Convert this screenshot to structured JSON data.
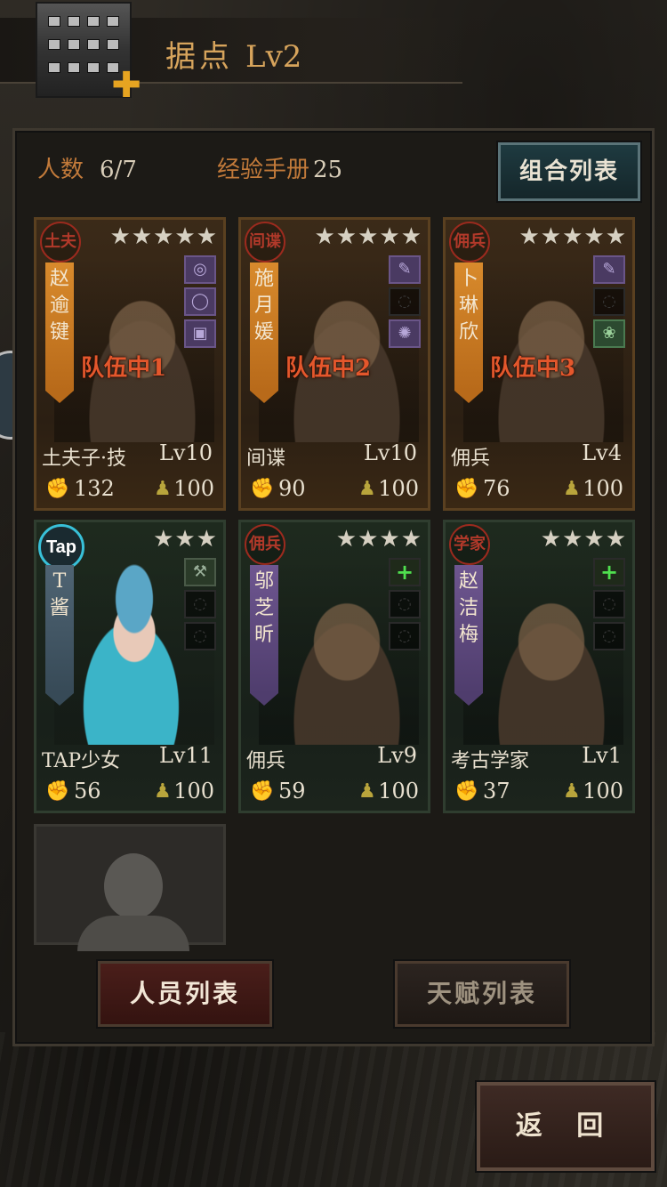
{
  "header": {
    "title": "据点",
    "level": "Lv2"
  },
  "stats": {
    "people_label": "人数",
    "people_value": "6/7",
    "exp_label": "经验手册",
    "exp_value": "25"
  },
  "combo_button": "组合列表",
  "cards": [
    {
      "stars": "★★★★★",
      "seal": "土夫",
      "name_vertical": "赵\n逾\n键",
      "team": "队伍中1",
      "class": "土夫子·技",
      "level": "Lv10",
      "power": "132",
      "stamina": "100"
    },
    {
      "stars": "★★★★★",
      "seal": "间谍",
      "name_vertical": "施\n月\n媛",
      "team": "队伍中2",
      "class": "间谍",
      "level": "Lv10",
      "power": "90",
      "stamina": "100"
    },
    {
      "stars": "★★★★★",
      "seal": "佣兵",
      "name_vertical": "卜\n琳\n欣",
      "team": "队伍中3",
      "class": "佣兵",
      "level": "Lv4",
      "power": "76",
      "stamina": "100"
    },
    {
      "stars": "★★★",
      "seal": "Tap",
      "name_vertical": "T\n酱",
      "team": "",
      "class": "TAP少女",
      "level": "Lv11",
      "power": "56",
      "stamina": "100"
    },
    {
      "stars": "★★★★",
      "seal": "佣兵",
      "name_vertical": "邬\n芝\n昕",
      "team": "",
      "class": "佣兵",
      "level": "Lv9",
      "power": "59",
      "stamina": "100"
    },
    {
      "stars": "★★★★",
      "seal": "学家",
      "name_vertical": "赵\n洁\n梅",
      "team": "",
      "class": "考古学家",
      "level": "Lv1",
      "power": "37",
      "stamina": "100"
    }
  ],
  "tabs": {
    "active": "人员列表",
    "inactive": "天赋列表"
  },
  "back_button": "返 回"
}
